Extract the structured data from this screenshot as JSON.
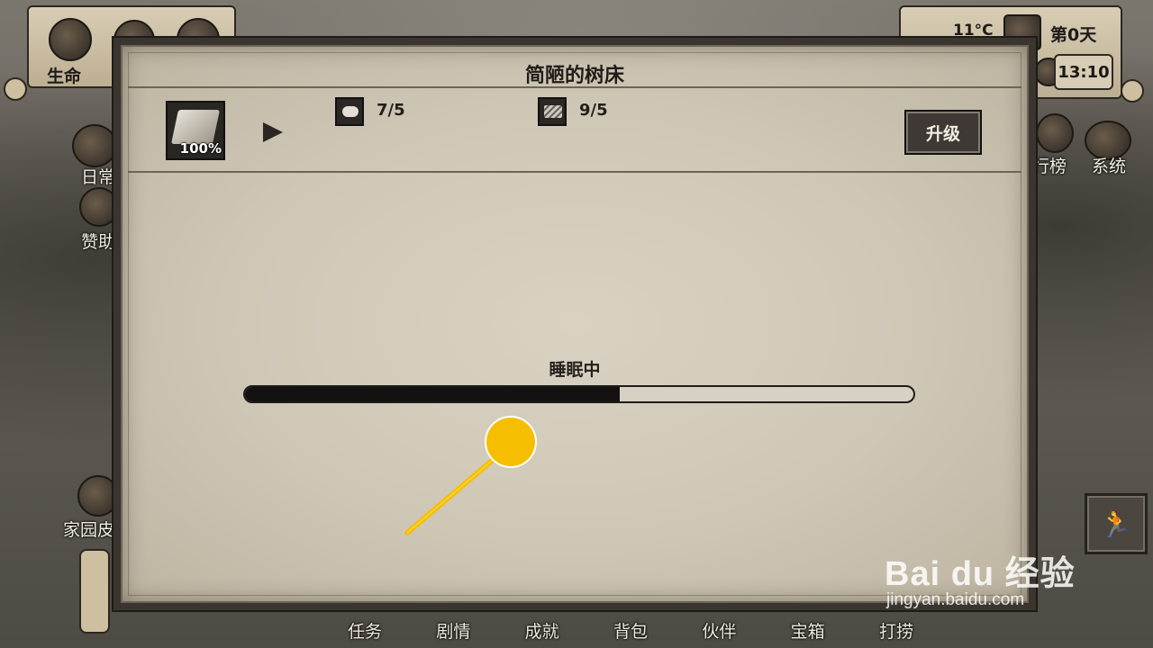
{
  "hud": {
    "health_label": "生命",
    "temperature": "11°C",
    "day": "第0天",
    "time": "13:10",
    "left_labels": [
      "日常",
      "赞助",
      "家园皮"
    ],
    "right_labels": [
      "行榜",
      "系统"
    ]
  },
  "dialog": {
    "title": "简陋的树床",
    "item_percent": "100%",
    "resources": [
      {
        "icon": "meat-icon",
        "amount": "7/5"
      },
      {
        "icon": "wood-icon",
        "amount": "9/5"
      }
    ],
    "upgrade_label": "升级",
    "status_text": "睡眠中",
    "progress": 0.56
  },
  "bottom_nav": [
    "任务",
    "剧情",
    "成就",
    "背包",
    "伙伴",
    "宝箱",
    "打捞"
  ],
  "watermark": {
    "logo": "Bai du 经验",
    "url": "jingyan.baidu.com"
  },
  "colors": {
    "pointer": "#f5bf00",
    "accent_dark": "#141210",
    "paper": "#d3ccbc"
  }
}
